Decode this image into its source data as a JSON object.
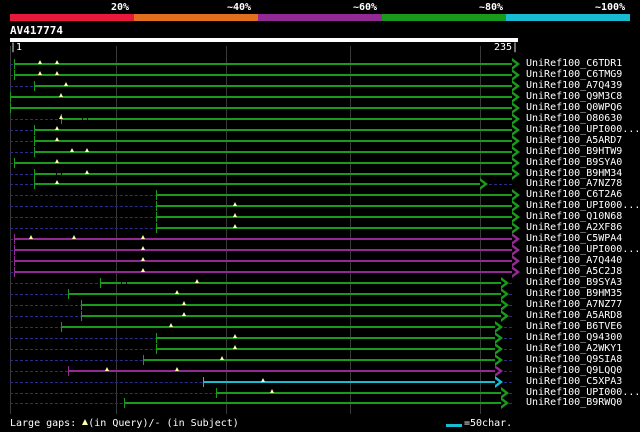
{
  "identity_scale": {
    "labels": [
      "20%",
      "~40%",
      "~60%",
      "~80%",
      "~100%"
    ],
    "colors": [
      "#e8193a",
      "#e26f1e",
      "#932a93",
      "#1a9a1a",
      "#18bcd2"
    ]
  },
  "query": {
    "id": "AV417774",
    "length": 235,
    "ruler_start_label": "|1",
    "ruler_end_label": "235|"
  },
  "hits": [
    {
      "label": "UniRef100_C6TDR1",
      "start": 3,
      "end": 235,
      "color": "#1a9a1a",
      "gaps": [
        15,
        23
      ]
    },
    {
      "label": "UniRef100_C6TMG9",
      "start": 3,
      "end": 235,
      "color": "#1a9a1a",
      "gaps": [
        15,
        23
      ]
    },
    {
      "label": "UniRef100_A7Q439",
      "start": 12,
      "end": 235,
      "color": "#1a9a1a",
      "gaps": [
        27
      ]
    },
    {
      "label": "UniRef100_Q9M3C8",
      "start": 1,
      "end": 235,
      "color": "#1a9a1a",
      "gaps": [
        25
      ]
    },
    {
      "label": "UniRef100_Q0WPQ6",
      "start": 1,
      "end": 235,
      "color": "#1a9a1a",
      "gaps": []
    },
    {
      "label": "UniRef100_O80630",
      "start": 25,
      "end": 235,
      "color": "#1a9a1a",
      "gaps": [
        25
      ],
      "subject_gaps": [
        36
      ]
    },
    {
      "label": "UniRef100_UPI000...",
      "start": 12,
      "end": 235,
      "color": "#1a9a1a",
      "gaps": [
        23
      ]
    },
    {
      "label": "UniRef100_A5ARD7",
      "start": 12,
      "end": 235,
      "color": "#1a9a1a",
      "gaps": [
        23
      ]
    },
    {
      "label": "UniRef100_B9HTW9",
      "start": 12,
      "end": 235,
      "color": "#1a9a1a",
      "gaps": [
        30,
        37
      ]
    },
    {
      "label": "UniRef100_B9SYA0",
      "start": 3,
      "end": 235,
      "color": "#1a9a1a",
      "gaps": [
        23
      ]
    },
    {
      "label": "UniRef100_B9HM34",
      "start": 12,
      "end": 235,
      "color": "#1a9a1a",
      "gaps": [
        37
      ],
      "subject_gaps": [
        24
      ]
    },
    {
      "label": "UniRef100_A7NZ78",
      "start": 12,
      "end": 220,
      "color": "#1a9a1a",
      "gaps": [
        23
      ]
    },
    {
      "label": "UniRef100_C6T2A6",
      "start": 69,
      "end": 235,
      "color": "#1a9a1a",
      "gaps": []
    },
    {
      "label": "UniRef100_UPI000...",
      "start": 69,
      "end": 235,
      "color": "#1a9a1a",
      "gaps": [
        106
      ]
    },
    {
      "label": "UniRef100_Q10N68",
      "start": 69,
      "end": 235,
      "color": "#1a9a1a",
      "gaps": [
        106
      ]
    },
    {
      "label": "UniRef100_A2XF86",
      "start": 69,
      "end": 235,
      "color": "#1a9a1a",
      "gaps": [
        106
      ]
    },
    {
      "label": "UniRef100_C5WPA4",
      "start": 3,
      "end": 235,
      "color": "#932a93",
      "gaps": [
        11,
        31,
        63
      ]
    },
    {
      "label": "UniRef100_UPI000...",
      "start": 3,
      "end": 235,
      "color": "#932a93",
      "gaps": [
        63
      ]
    },
    {
      "label": "UniRef100_A7Q440",
      "start": 3,
      "end": 235,
      "color": "#932a93",
      "gaps": [
        63
      ]
    },
    {
      "label": "UniRef100_A5C2J8",
      "start": 3,
      "end": 235,
      "color": "#932a93",
      "gaps": [
        63
      ]
    },
    {
      "label": "UniRef100_B9SYA3",
      "start": 43,
      "end": 230,
      "color": "#1a9a1a",
      "gaps": [
        88
      ],
      "subject_gaps": [
        54
      ]
    },
    {
      "label": "UniRef100_B9HM35",
      "start": 28,
      "end": 230,
      "color": "#1a9a1a",
      "gaps": [
        79
      ]
    },
    {
      "label": "UniRef100_A7NZ77",
      "start": 34,
      "end": 230,
      "color": "#1a9a1a",
      "gaps": [
        82
      ]
    },
    {
      "label": "UniRef100_A5ARD8",
      "start": 34,
      "end": 230,
      "color": "#1a9a1a",
      "gaps": [
        82
      ]
    },
    {
      "label": "UniRef100_B6TVE6",
      "start": 25,
      "end": 227,
      "color": "#1a9a1a",
      "gaps": [
        76
      ]
    },
    {
      "label": "UniRef100_Q94300",
      "start": 69,
      "end": 227,
      "color": "#1a9a1a",
      "gaps": [
        106
      ]
    },
    {
      "label": "UniRef100_A2WKY1",
      "start": 69,
      "end": 227,
      "color": "#1a9a1a",
      "gaps": [
        106
      ]
    },
    {
      "label": "UniRef100_Q9SIA8",
      "start": 63,
      "end": 227,
      "color": "#1a9a1a",
      "gaps": [
        100
      ]
    },
    {
      "label": "UniRef100_Q9LQQ0",
      "start": 28,
      "end": 227,
      "color": "#932a93",
      "gaps": [
        46,
        79
      ]
    },
    {
      "label": "UniRef100_C5XPA3",
      "start": 91,
      "end": 227,
      "color": "#18bcd2",
      "gaps": [
        119
      ]
    },
    {
      "label": "UniRef100_UPI000...",
      "start": 97,
      "end": 230,
      "color": "#1a9a1a",
      "gaps": [
        123
      ]
    },
    {
      "label": "UniRef100_B9RWQ0",
      "start": 54,
      "end": 230,
      "color": "#1a9a1a",
      "gaps": []
    }
  ],
  "legend": {
    "label": "Large gaps:",
    "query_note": "(in Query)/",
    "subject_dash": "-",
    "subject_note": " (in Subject)",
    "scale_text": "=50char."
  }
}
